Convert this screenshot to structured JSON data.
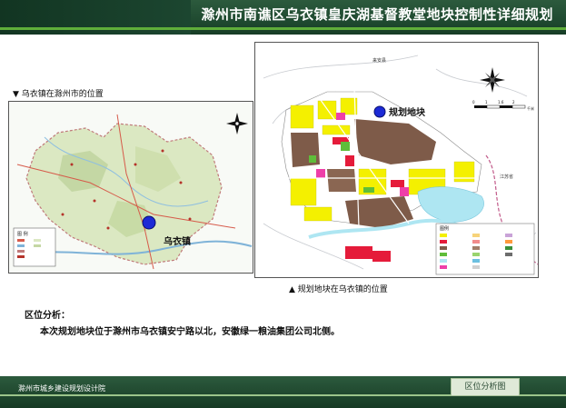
{
  "header": {
    "title": "滁州市南谯区乌衣镇皇庆湖基督教堂地块控制性详细规划"
  },
  "left_map": {
    "caption": "乌衣镇在滁州市的位置",
    "marker_label": "乌衣镇",
    "legend_title": "图 例"
  },
  "right_map": {
    "caption": "规划地块在乌衣镇的位置",
    "marker_label": "规划地块",
    "place_north": "来安县",
    "place_east": "江苏省",
    "legend_title": "图例",
    "scale_labels": [
      "0",
      "1",
      "1.6",
      "2",
      "千米"
    ]
  },
  "analysis": {
    "heading": "区位分析：",
    "body": "本次规划地块位于滁州市乌衣镇安宁路以北，安徽绿一粮油集团公司北侧。"
  },
  "footer": {
    "org": "滁州市城乡建设规划设计院",
    "tag": "区位分析图"
  },
  "colors": {
    "header_green": "#1f4a30",
    "marker_blue": "#1c2ad6",
    "residential_yellow": "#f4f000",
    "commercial_red": "#e51b3a",
    "industrial_brown": "#7e5b49",
    "water_cyan": "#aee6f2"
  }
}
